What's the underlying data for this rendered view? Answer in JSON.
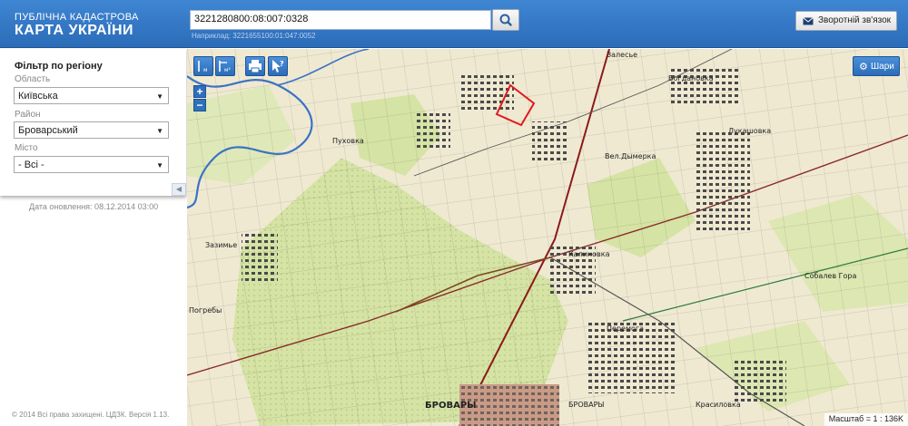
{
  "header": {
    "brand_top": "ПУБЛІЧНА КАДАСТРОВА",
    "brand_main": "КАРТА УКРАЇНИ",
    "search_value": "3221280800:08:007:0328",
    "search_hint": "Наприклад: 3221655100:01:047:0052",
    "feedback_label": "Зворотній зв'язок"
  },
  "sidebar": {
    "filter_title": "Фільтр по регіону",
    "oblast_label": "Область",
    "oblast_value": "Київська",
    "rayon_label": "Район",
    "rayon_value": "Броварський",
    "misto_label": "Місто",
    "misto_value": "- Всі -",
    "update_date": "Дата оновлення: 08.12.2014 03:00",
    "copyright": "© 2014 Всі права захищені. ЦДЗК. Версія 1.13."
  },
  "map": {
    "layers_label": "Шари",
    "scale_text": "Масштаб = 1 : 136K",
    "zoom_in": "+",
    "zoom_out": "−",
    "places": {
      "pukhivka": "Пуховка",
      "velyka_dymerka": "Вел.Дымерка",
      "kalynivka": "Калиновка",
      "brovary": "БРОВАРЫ",
      "brovary2": "БРОВАРЫ",
      "krasylivka": "Красиловка",
      "bohdanivka": "Богдановка",
      "zazymia": "Зазимье",
      "pohreby": "Погребы",
      "zalissia": "Залесье",
      "sobolev_hora": "Собалев Гора",
      "peremoha": "Перемога",
      "lukashivka": "Лукашовка"
    },
    "colors": {
      "paper": "#efe9d2",
      "forest": "#d5e3a4",
      "parcel": "#e0191e",
      "water": "#3a73c4",
      "rail": "#8b1a1a"
    }
  }
}
